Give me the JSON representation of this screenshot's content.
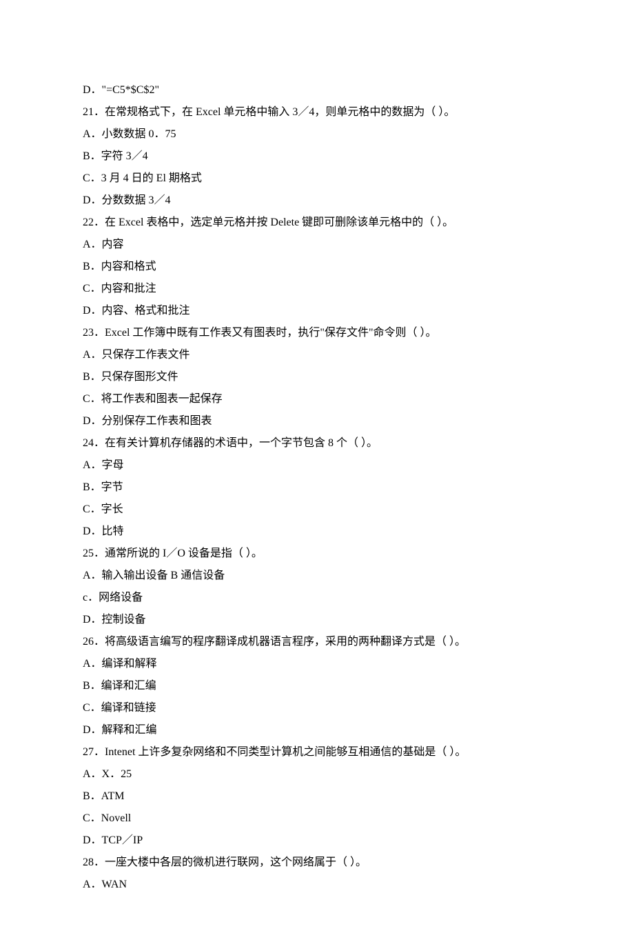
{
  "lines": [
    "D．\"=C5*$C$2\"",
    "21．在常规格式下，在 Excel 单元格中输入 3／4，则单元格中的数据为（   ）。",
    "A．小数数据 0．75",
    "B．字符 3／4",
    "C．3 月 4 日的 El 期格式",
    "D．分数数据 3／4",
    "22．在 Excel 表格中，选定单元格并按 Delete 键即可删除该单元格中的（   ）。",
    "A．内容",
    "B．内容和格式",
    "C．内容和批注",
    "D．内容、格式和批注",
    "23．Excel 工作簿中既有工作表又有图表时，执行\"保存文件\"命令则（   ）。",
    "A．只保存工作表文件",
    "B．只保存图形文件",
    "C．将工作表和图表一起保存",
    "D．分别保存工作表和图表",
    "24．在有关计算机存储器的术语中，一个字节包含 8 个（   ）。",
    "A．字母",
    "B．字节",
    "C．字长",
    "D．比特",
    "25．通常所说的 I／O 设备是指（   ）。",
    "A．输入输出设备 B 通信设备",
    "c．网络设备",
    "D．控制设备",
    "26．将高级语言编写的程序翻译成机器语言程序，采用的两种翻译方式是（   ）。",
    "A．编译和解释",
    "B．编译和汇编",
    "C．编译和链接",
    "D．解释和汇编",
    "27．Intenet 上许多复杂网络和不同类型计算机之间能够互相通信的基础是（   ）。",
    "A．X．25",
    "B．ATM",
    "C．Novell",
    "D．TCP／IP",
    "28．一座大楼中各层的微机进行联网，这个网络属于（   ）。",
    "A．WAN"
  ]
}
